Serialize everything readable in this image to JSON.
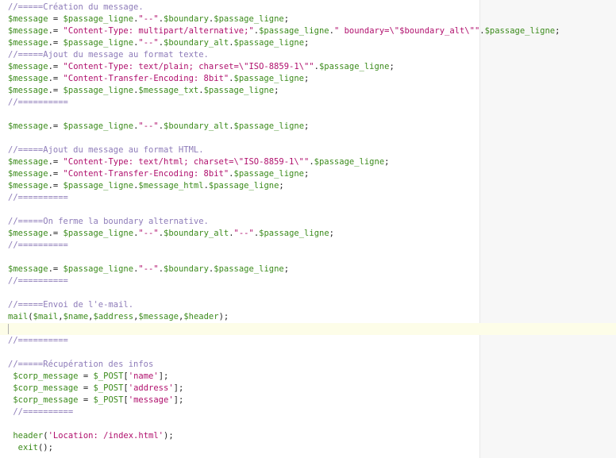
{
  "editor": {
    "current_line": 27,
    "lines": [
      [
        [
          "c",
          "//=====Création du message."
        ]
      ],
      [
        [
          "v",
          "$message"
        ],
        [
          "o",
          " = "
        ],
        [
          "v",
          "$passage_ligne"
        ],
        [
          "o",
          "."
        ],
        [
          "s",
          "\"--\""
        ],
        [
          "o",
          "."
        ],
        [
          "v",
          "$boundary"
        ],
        [
          "o",
          "."
        ],
        [
          "v",
          "$passage_ligne"
        ],
        [
          "o",
          ";"
        ]
      ],
      [
        [
          "v",
          "$message"
        ],
        [
          "o",
          ".= "
        ],
        [
          "s",
          "\"Content-Type: multipart/alternative;\""
        ],
        [
          "o",
          "."
        ],
        [
          "v",
          "$passage_ligne"
        ],
        [
          "o",
          "."
        ],
        [
          "s",
          "\" boundary=\\\"$boundary_alt\\\"\""
        ],
        [
          "o",
          "."
        ],
        [
          "v",
          "$passage_ligne"
        ],
        [
          "o",
          ";"
        ]
      ],
      [
        [
          "v",
          "$message"
        ],
        [
          "o",
          ".= "
        ],
        [
          "v",
          "$passage_ligne"
        ],
        [
          "o",
          "."
        ],
        [
          "s",
          "\"--\""
        ],
        [
          "o",
          "."
        ],
        [
          "v",
          "$boundary_alt"
        ],
        [
          "o",
          "."
        ],
        [
          "v",
          "$passage_ligne"
        ],
        [
          "o",
          ";"
        ]
      ],
      [
        [
          "c",
          "//=====Ajout du message au format texte."
        ]
      ],
      [
        [
          "v",
          "$message"
        ],
        [
          "o",
          ".= "
        ],
        [
          "s",
          "\"Content-Type: text/plain; charset=\\\"ISO-8859-1\\\"\""
        ],
        [
          "o",
          "."
        ],
        [
          "v",
          "$passage_ligne"
        ],
        [
          "o",
          ";"
        ]
      ],
      [
        [
          "v",
          "$message"
        ],
        [
          "o",
          ".= "
        ],
        [
          "s",
          "\"Content-Transfer-Encoding: 8bit\""
        ],
        [
          "o",
          "."
        ],
        [
          "v",
          "$passage_ligne"
        ],
        [
          "o",
          ";"
        ]
      ],
      [
        [
          "v",
          "$message"
        ],
        [
          "o",
          ".= "
        ],
        [
          "v",
          "$passage_ligne"
        ],
        [
          "o",
          "."
        ],
        [
          "v",
          "$message_txt"
        ],
        [
          "o",
          "."
        ],
        [
          "v",
          "$passage_ligne"
        ],
        [
          "o",
          ";"
        ]
      ],
      [
        [
          "c",
          "//=========="
        ]
      ],
      [],
      [
        [
          "v",
          "$message"
        ],
        [
          "o",
          ".= "
        ],
        [
          "v",
          "$passage_ligne"
        ],
        [
          "o",
          "."
        ],
        [
          "s",
          "\"--\""
        ],
        [
          "o",
          "."
        ],
        [
          "v",
          "$boundary_alt"
        ],
        [
          "o",
          "."
        ],
        [
          "v",
          "$passage_ligne"
        ],
        [
          "o",
          ";"
        ]
      ],
      [],
      [
        [
          "c",
          "//=====Ajout du message au format HTML."
        ]
      ],
      [
        [
          "v",
          "$message"
        ],
        [
          "o",
          ".= "
        ],
        [
          "s",
          "\"Content-Type: text/html; charset=\\\"ISO-8859-1\\\"\""
        ],
        [
          "o",
          "."
        ],
        [
          "v",
          "$passage_ligne"
        ],
        [
          "o",
          ";"
        ]
      ],
      [
        [
          "v",
          "$message"
        ],
        [
          "o",
          ".= "
        ],
        [
          "s",
          "\"Content-Transfer-Encoding: 8bit\""
        ],
        [
          "o",
          "."
        ],
        [
          "v",
          "$passage_ligne"
        ],
        [
          "o",
          ";"
        ]
      ],
      [
        [
          "v",
          "$message"
        ],
        [
          "o",
          ".= "
        ],
        [
          "v",
          "$passage_ligne"
        ],
        [
          "o",
          "."
        ],
        [
          "v",
          "$message_html"
        ],
        [
          "o",
          "."
        ],
        [
          "v",
          "$passage_ligne"
        ],
        [
          "o",
          ";"
        ]
      ],
      [
        [
          "c",
          "//=========="
        ]
      ],
      [],
      [
        [
          "c",
          "//=====On ferme la boundary alternative."
        ]
      ],
      [
        [
          "v",
          "$message"
        ],
        [
          "o",
          ".= "
        ],
        [
          "v",
          "$passage_ligne"
        ],
        [
          "o",
          "."
        ],
        [
          "s",
          "\"--\""
        ],
        [
          "o",
          "."
        ],
        [
          "v",
          "$boundary_alt"
        ],
        [
          "o",
          "."
        ],
        [
          "s",
          "\"--\""
        ],
        [
          "o",
          "."
        ],
        [
          "v",
          "$passage_ligne"
        ],
        [
          "o",
          ";"
        ]
      ],
      [
        [
          "c",
          "//=========="
        ]
      ],
      [],
      [
        [
          "v",
          "$message"
        ],
        [
          "o",
          ".= "
        ],
        [
          "v",
          "$passage_ligne"
        ],
        [
          "o",
          "."
        ],
        [
          "s",
          "\"--\""
        ],
        [
          "o",
          "."
        ],
        [
          "v",
          "$boundary"
        ],
        [
          "o",
          "."
        ],
        [
          "v",
          "$passage_ligne"
        ],
        [
          "o",
          ";"
        ]
      ],
      [
        [
          "c",
          "//=========="
        ]
      ],
      [],
      [
        [
          "c",
          "//=====Envoi de l'e-mail."
        ]
      ],
      [
        [
          "f",
          "mail"
        ],
        [
          "o",
          "("
        ],
        [
          "v",
          "$mail"
        ],
        [
          "o",
          ","
        ],
        [
          "v",
          "$name"
        ],
        [
          "o",
          ","
        ],
        [
          "v",
          "$address"
        ],
        [
          "o",
          ","
        ],
        [
          "v",
          "$message"
        ],
        [
          "o",
          ","
        ],
        [
          "v",
          "$header"
        ],
        [
          "o",
          ");"
        ]
      ],
      [],
      [
        [
          "c",
          "//=========="
        ]
      ],
      [],
      [
        [
          "c",
          "//=====Récupération des infos"
        ]
      ],
      [
        [
          "o",
          " "
        ],
        [
          "v",
          "$corp_message"
        ],
        [
          "o",
          " = "
        ],
        [
          "v",
          "$_POST"
        ],
        [
          "o",
          "["
        ],
        [
          "s",
          "'name'"
        ],
        [
          "o",
          "];"
        ]
      ],
      [
        [
          "o",
          " "
        ],
        [
          "v",
          "$corp_message"
        ],
        [
          "o",
          " = "
        ],
        [
          "v",
          "$_POST"
        ],
        [
          "o",
          "["
        ],
        [
          "s",
          "'address'"
        ],
        [
          "o",
          "];"
        ]
      ],
      [
        [
          "o",
          " "
        ],
        [
          "v",
          "$corp_message"
        ],
        [
          "o",
          " = "
        ],
        [
          "v",
          "$_POST"
        ],
        [
          "o",
          "["
        ],
        [
          "s",
          "'message'"
        ],
        [
          "o",
          "];"
        ]
      ],
      [
        [
          "o",
          " "
        ],
        [
          "c",
          "//=========="
        ]
      ],
      [],
      [
        [
          "o",
          " "
        ],
        [
          "f",
          "header"
        ],
        [
          "o",
          "("
        ],
        [
          "s",
          "'Location: /index.html'"
        ],
        [
          "o",
          ");"
        ]
      ],
      [
        [
          "o",
          "  "
        ],
        [
          "f",
          "exit"
        ],
        [
          "o",
          "();"
        ]
      ]
    ]
  }
}
